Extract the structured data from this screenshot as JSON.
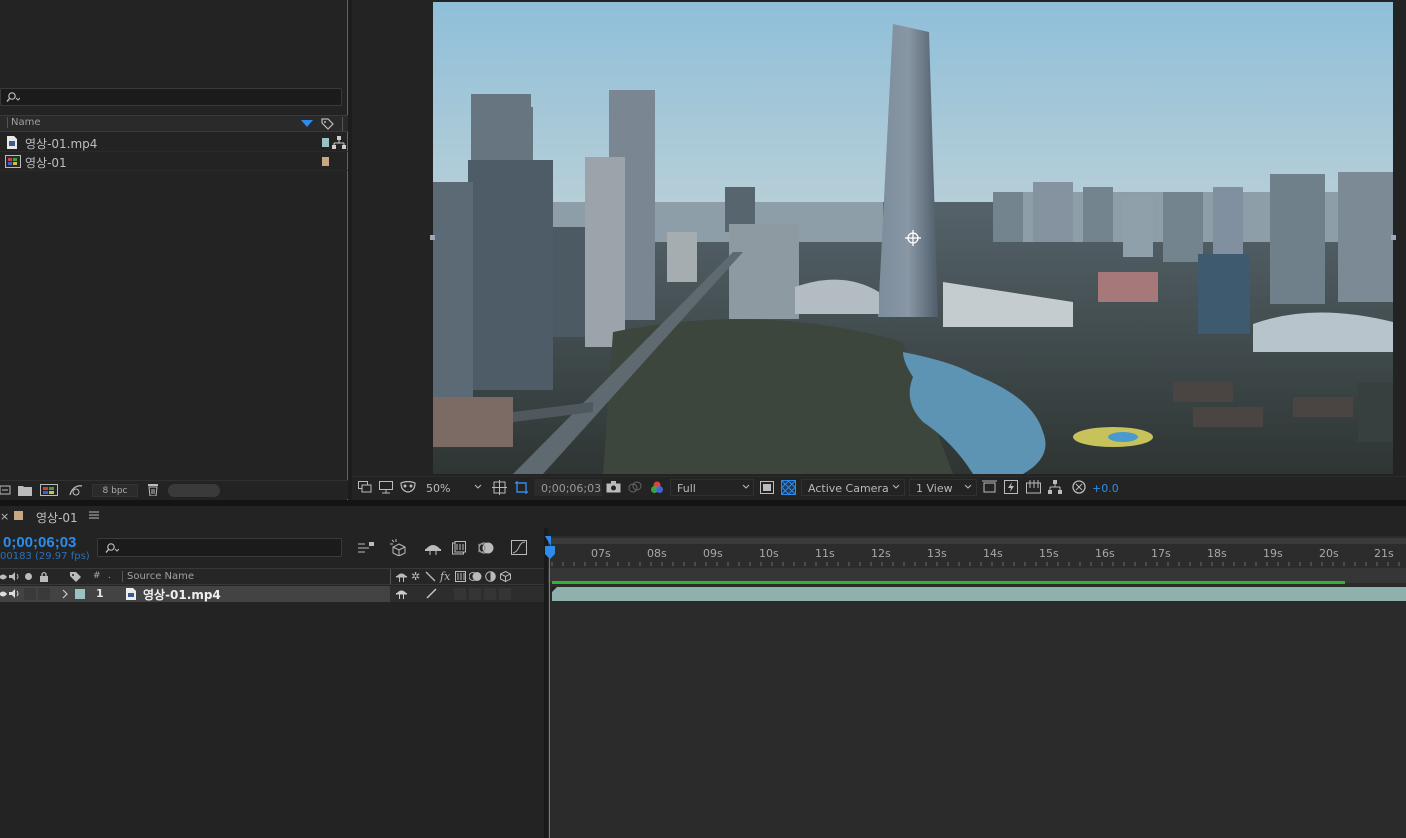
{
  "project": {
    "header_name": "Name",
    "items": [
      {
        "name": "영상-01.mp4",
        "swatch": "#9bc3c3"
      },
      {
        "name": "영상-01",
        "swatch": "#c8a882"
      }
    ],
    "bpc": "8 bpc"
  },
  "viewer": {
    "zoom": "50%",
    "timecode": "0;00;06;03",
    "resolution": "Full",
    "camera": "Active Camera",
    "views": "1 View",
    "exposure": "+0.0"
  },
  "timeline": {
    "comp_name": "영상-01",
    "timecode": "0;00;06;03",
    "frames_fps": "00183 (29.97 fps)",
    "source_name_header": "Source Name",
    "layer": {
      "index": "1",
      "name": "영상-01.mp4",
      "label_color": "#9bc3c3"
    },
    "ruler_labels": [
      "07s",
      "08s",
      "09s",
      "10s",
      "11s",
      "12s",
      "13s",
      "14s",
      "15s",
      "16s",
      "17s",
      "18s",
      "19s",
      "20s",
      "21s"
    ]
  },
  "colors": {
    "accent": "#2d8ceb",
    "green": "#2fb52f"
  }
}
